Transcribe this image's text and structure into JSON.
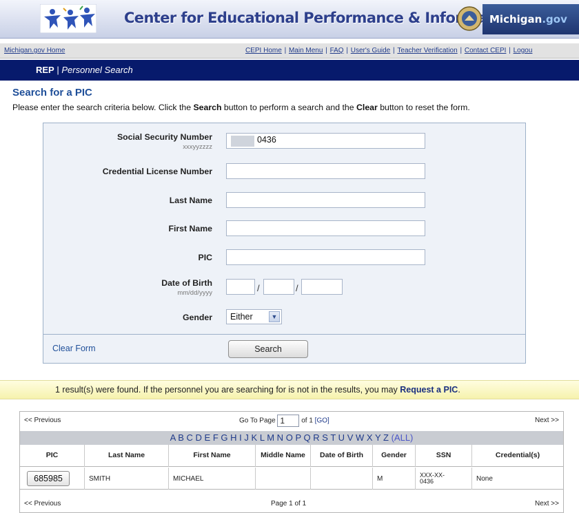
{
  "header": {
    "title": "Center for Educational Performance & Information",
    "michigan_gov": "Michigan",
    "michigan_gov_suffix": ".gov"
  },
  "utility_nav": {
    "left_link": "Michigan.gov Home",
    "links": [
      "CEPI Home",
      "Main Menu",
      "FAQ",
      "User's Guide",
      "Teacher Verification",
      "Contact CEPI",
      "Logou"
    ]
  },
  "titlebar": {
    "app": "REP",
    "separator": "|",
    "page": "Personnel Search"
  },
  "page": {
    "heading": "Search for a PIC",
    "instructions_1": "Please enter the search criteria below. Click the ",
    "instructions_search": "Search",
    "instructions_2": " button to perform a search and the ",
    "instructions_clear": "Clear",
    "instructions_3": " button to reset the form."
  },
  "form": {
    "ssn_label": "Social Security Number",
    "ssn_hint": "xxxyyzzzz",
    "ssn_value": "0436",
    "credential_label": "Credential License Number",
    "credential_value": "",
    "last_name_label": "Last Name",
    "last_name_value": "",
    "first_name_label": "First Name",
    "first_name_value": "",
    "pic_label": "PIC",
    "pic_value": "",
    "dob_label": "Date of Birth",
    "dob_hint": "mm/dd/yyyy",
    "dob_separator": "/",
    "gender_label": "Gender",
    "gender_value": "Either",
    "clear_label": "Clear Form",
    "search_label": "Search"
  },
  "results": {
    "message_1": "1 result(s) were found. If the personnel you are searching for is not in the results, you may ",
    "message_link": "Request a PIC",
    "message_2": ".",
    "prev_label": "<< Previous",
    "next_label": "Next >>",
    "goto_label": "Go To Page",
    "goto_value": "1",
    "of_label": "of 1",
    "go_label": "[GO]",
    "letters": [
      "A",
      "B",
      "C",
      "D",
      "E",
      "F",
      "G",
      "H",
      "I",
      "J",
      "K",
      "L",
      "M",
      "N",
      "O",
      "P",
      "Q",
      "R",
      "S",
      "T",
      "U",
      "V",
      "W",
      "X",
      "Y",
      "Z"
    ],
    "all_label": "(ALL)",
    "columns": [
      "PIC",
      "Last Name",
      "First Name",
      "Middle Name",
      "Date of Birth",
      "Gender",
      "SSN",
      "Credential(s)"
    ],
    "rows": [
      {
        "pic": "685985",
        "last_name": "SMITH",
        "first_name": "MICHAEL",
        "middle_name": "",
        "dob": "",
        "gender": "M",
        "ssn_1": "XXX-XX-",
        "ssn_2": "0436",
        "credentials": "None"
      }
    ],
    "page_label": "Page 1 of 1"
  }
}
